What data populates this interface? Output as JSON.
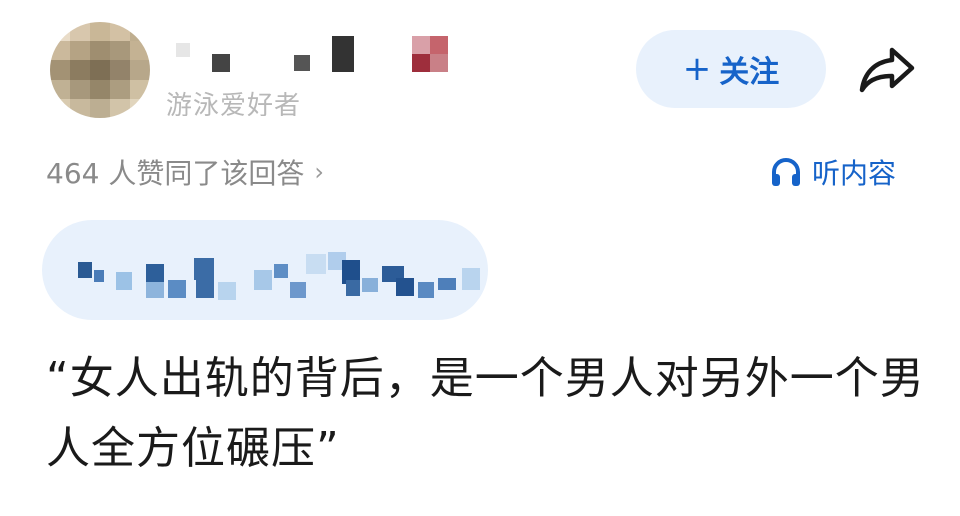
{
  "author": {
    "bio": "游泳爱好者"
  },
  "actions": {
    "follow_label": "关注",
    "follow_icon": "plus-icon",
    "share_icon": "share-icon"
  },
  "stats": {
    "likes_text": "464 人赞同了该回答",
    "chevron": "›",
    "listen_label": "听内容",
    "listen_icon": "headphones-icon"
  },
  "colors": {
    "accent": "#1663c9",
    "pill_bg": "#e8f1fc",
    "muted": "#8a8a8a"
  },
  "content": {
    "headline": "“女人出轨的背后，是一个男人对另外一个男人全方位碾压”"
  }
}
